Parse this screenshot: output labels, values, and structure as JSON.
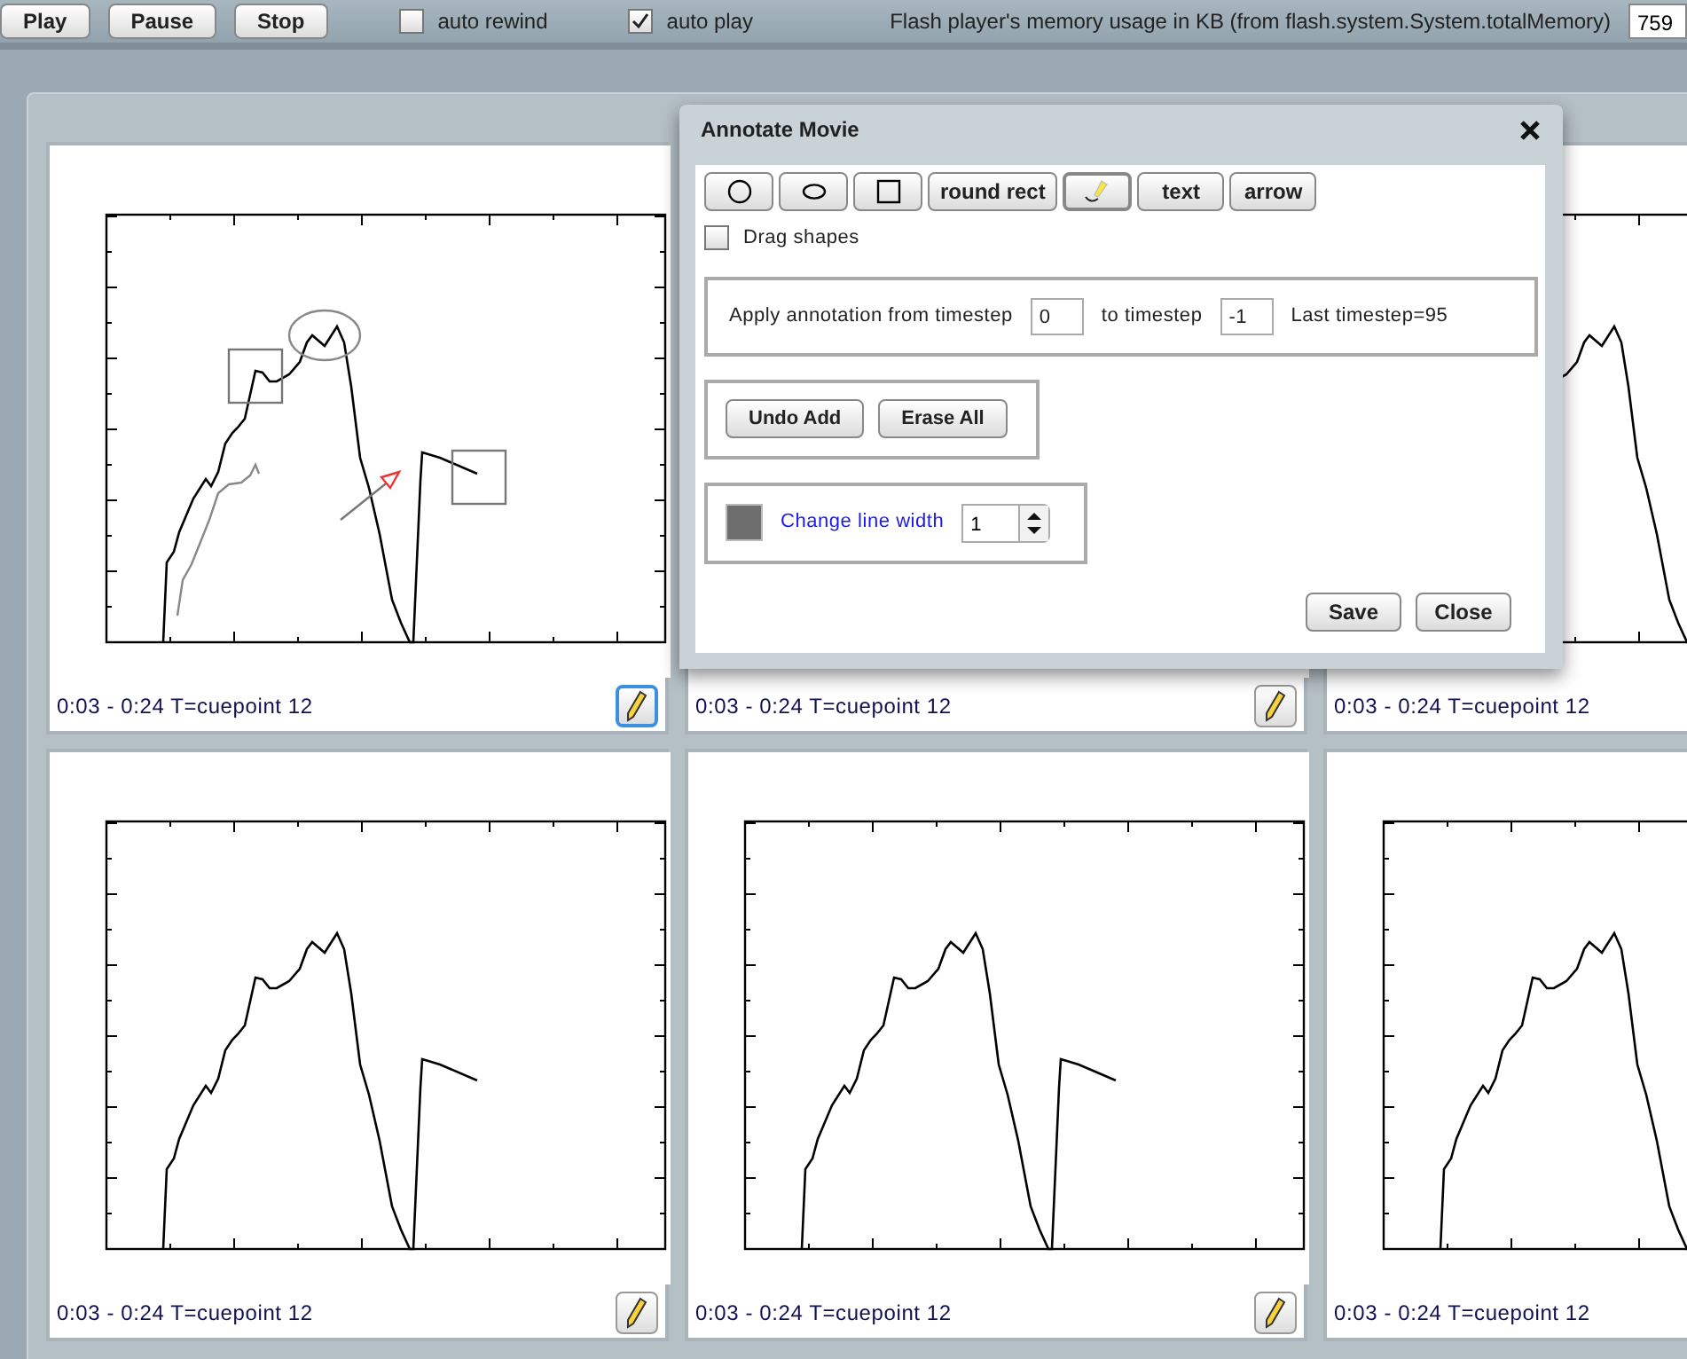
{
  "toolbar": {
    "buttons": [
      "Play",
      "Pause",
      "Stop"
    ],
    "checkboxes": [
      {
        "label": "auto rewind",
        "checked": false
      },
      {
        "label": "auto play",
        "checked": true
      }
    ],
    "memory": {
      "label": "Flash player's memory usage in KB (from flash.system.System.totalMemory)",
      "value": "759"
    }
  },
  "cards": [
    {
      "caption": "0:03 - 0:24 T=cuepoint 12",
      "selected": true,
      "annotations": [
        {
          "kind": "ellipse"
        },
        {
          "kind": "square"
        },
        {
          "kind": "square"
        },
        {
          "kind": "arrow"
        },
        {
          "kind": "freehand"
        }
      ]
    },
    {
      "caption": "0:03 - 0:24 T=cuepoint 12",
      "selected": false
    },
    {
      "caption": "0:03 - 0:24 T=cuepoint 12"
    },
    {
      "caption": "0:03 - 0:24 T=cuepoint 12",
      "selected": false
    },
    {
      "caption": "0:03 - 0:24 T=cuepoint 12",
      "selected": false
    },
    {
      "caption": "0:03 - 0:24 T=cuepoint 12"
    }
  ],
  "dialog": {
    "title": "Annotate Movie",
    "tools": [
      {
        "kind": "circle",
        "selected": false
      },
      {
        "kind": "ellipse",
        "selected": false
      },
      {
        "kind": "square",
        "selected": false
      },
      {
        "kind": "label",
        "label": "round rect",
        "selected": false
      },
      {
        "kind": "pencil",
        "selected": true
      },
      {
        "kind": "label",
        "label": "text",
        "selected": false
      },
      {
        "kind": "label",
        "label": "arrow",
        "selected": false
      }
    ],
    "drag_shapes": {
      "label": "Drag shapes",
      "checked": false
    },
    "timestep": {
      "from_label": "Apply annotation from timestep",
      "from_value": "0",
      "to_label": "to timestep",
      "to_value": "-1",
      "last": "Last timestep=95"
    },
    "edit_buttons": [
      "Undo Add",
      "Erase All"
    ],
    "line": {
      "color": "#6e6e6e",
      "label": "Change line width",
      "value": "1"
    },
    "buttons": [
      "Save",
      "Close"
    ]
  }
}
